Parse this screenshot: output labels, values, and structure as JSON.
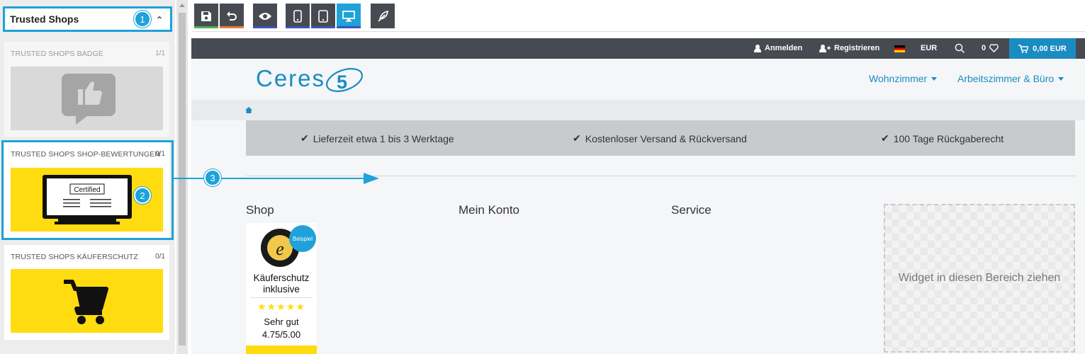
{
  "sidebar": {
    "section_title": "Trusted Shops",
    "widgets": [
      {
        "title": "TRUSTED SHOPS BADGE",
        "count": "1/1"
      },
      {
        "title": "TRUSTED SHOPS SHOP-BEWERTUNGEN",
        "count": "0/1",
        "image_text": "Certified"
      },
      {
        "title": "TRUSTED SHOPS KÄUFERSCHUTZ",
        "count": "0/1"
      }
    ]
  },
  "annotations": [
    "1",
    "2",
    "3"
  ],
  "toolbar": {
    "buttons": [
      "save-icon",
      "undo-icon",
      "preview-eye-icon",
      "mobile-icon",
      "tablet-icon",
      "desktop-icon",
      "feather-icon"
    ],
    "bar_colors": [
      "#4caf50",
      "#e57c3c",
      "#3f51b5",
      "#3f51b5",
      "#3f51b5",
      "#3f51b5",
      "#474b51"
    ],
    "active": "desktop-icon"
  },
  "shop": {
    "topbar": {
      "login": "Anmelden",
      "register": "Registrieren",
      "currency": "EUR",
      "wishlist_count": "0",
      "cart_total": "0,00 EUR"
    },
    "logo_text": "Ceres",
    "logo_number": "5",
    "nav": [
      "Wohnzimmer",
      "Arbeitszimmer & Büro"
    ],
    "usp": [
      "Lieferzeit etwa 1 bis 3 Werktage",
      "Kostenloser Versand & Rückversand",
      "100 Tage Rückgaberecht"
    ],
    "footer_titles": [
      "Shop",
      "Mein Konto",
      "Service"
    ],
    "dropzone_text": "Widget in diesen Bereich ziehen",
    "ts_badge": {
      "ribbon": "Beispiel",
      "line1": "Käuferschutz",
      "line2": "inklusive",
      "stars": "★★★★★",
      "rating_text": "Sehr gut",
      "rating_value": "4.75/5.00"
    }
  },
  "colors": {
    "accent": "#1ea2d9",
    "brand": "#1b8cc2",
    "yellow": "#ffdc0f",
    "dark": "#474b51"
  }
}
